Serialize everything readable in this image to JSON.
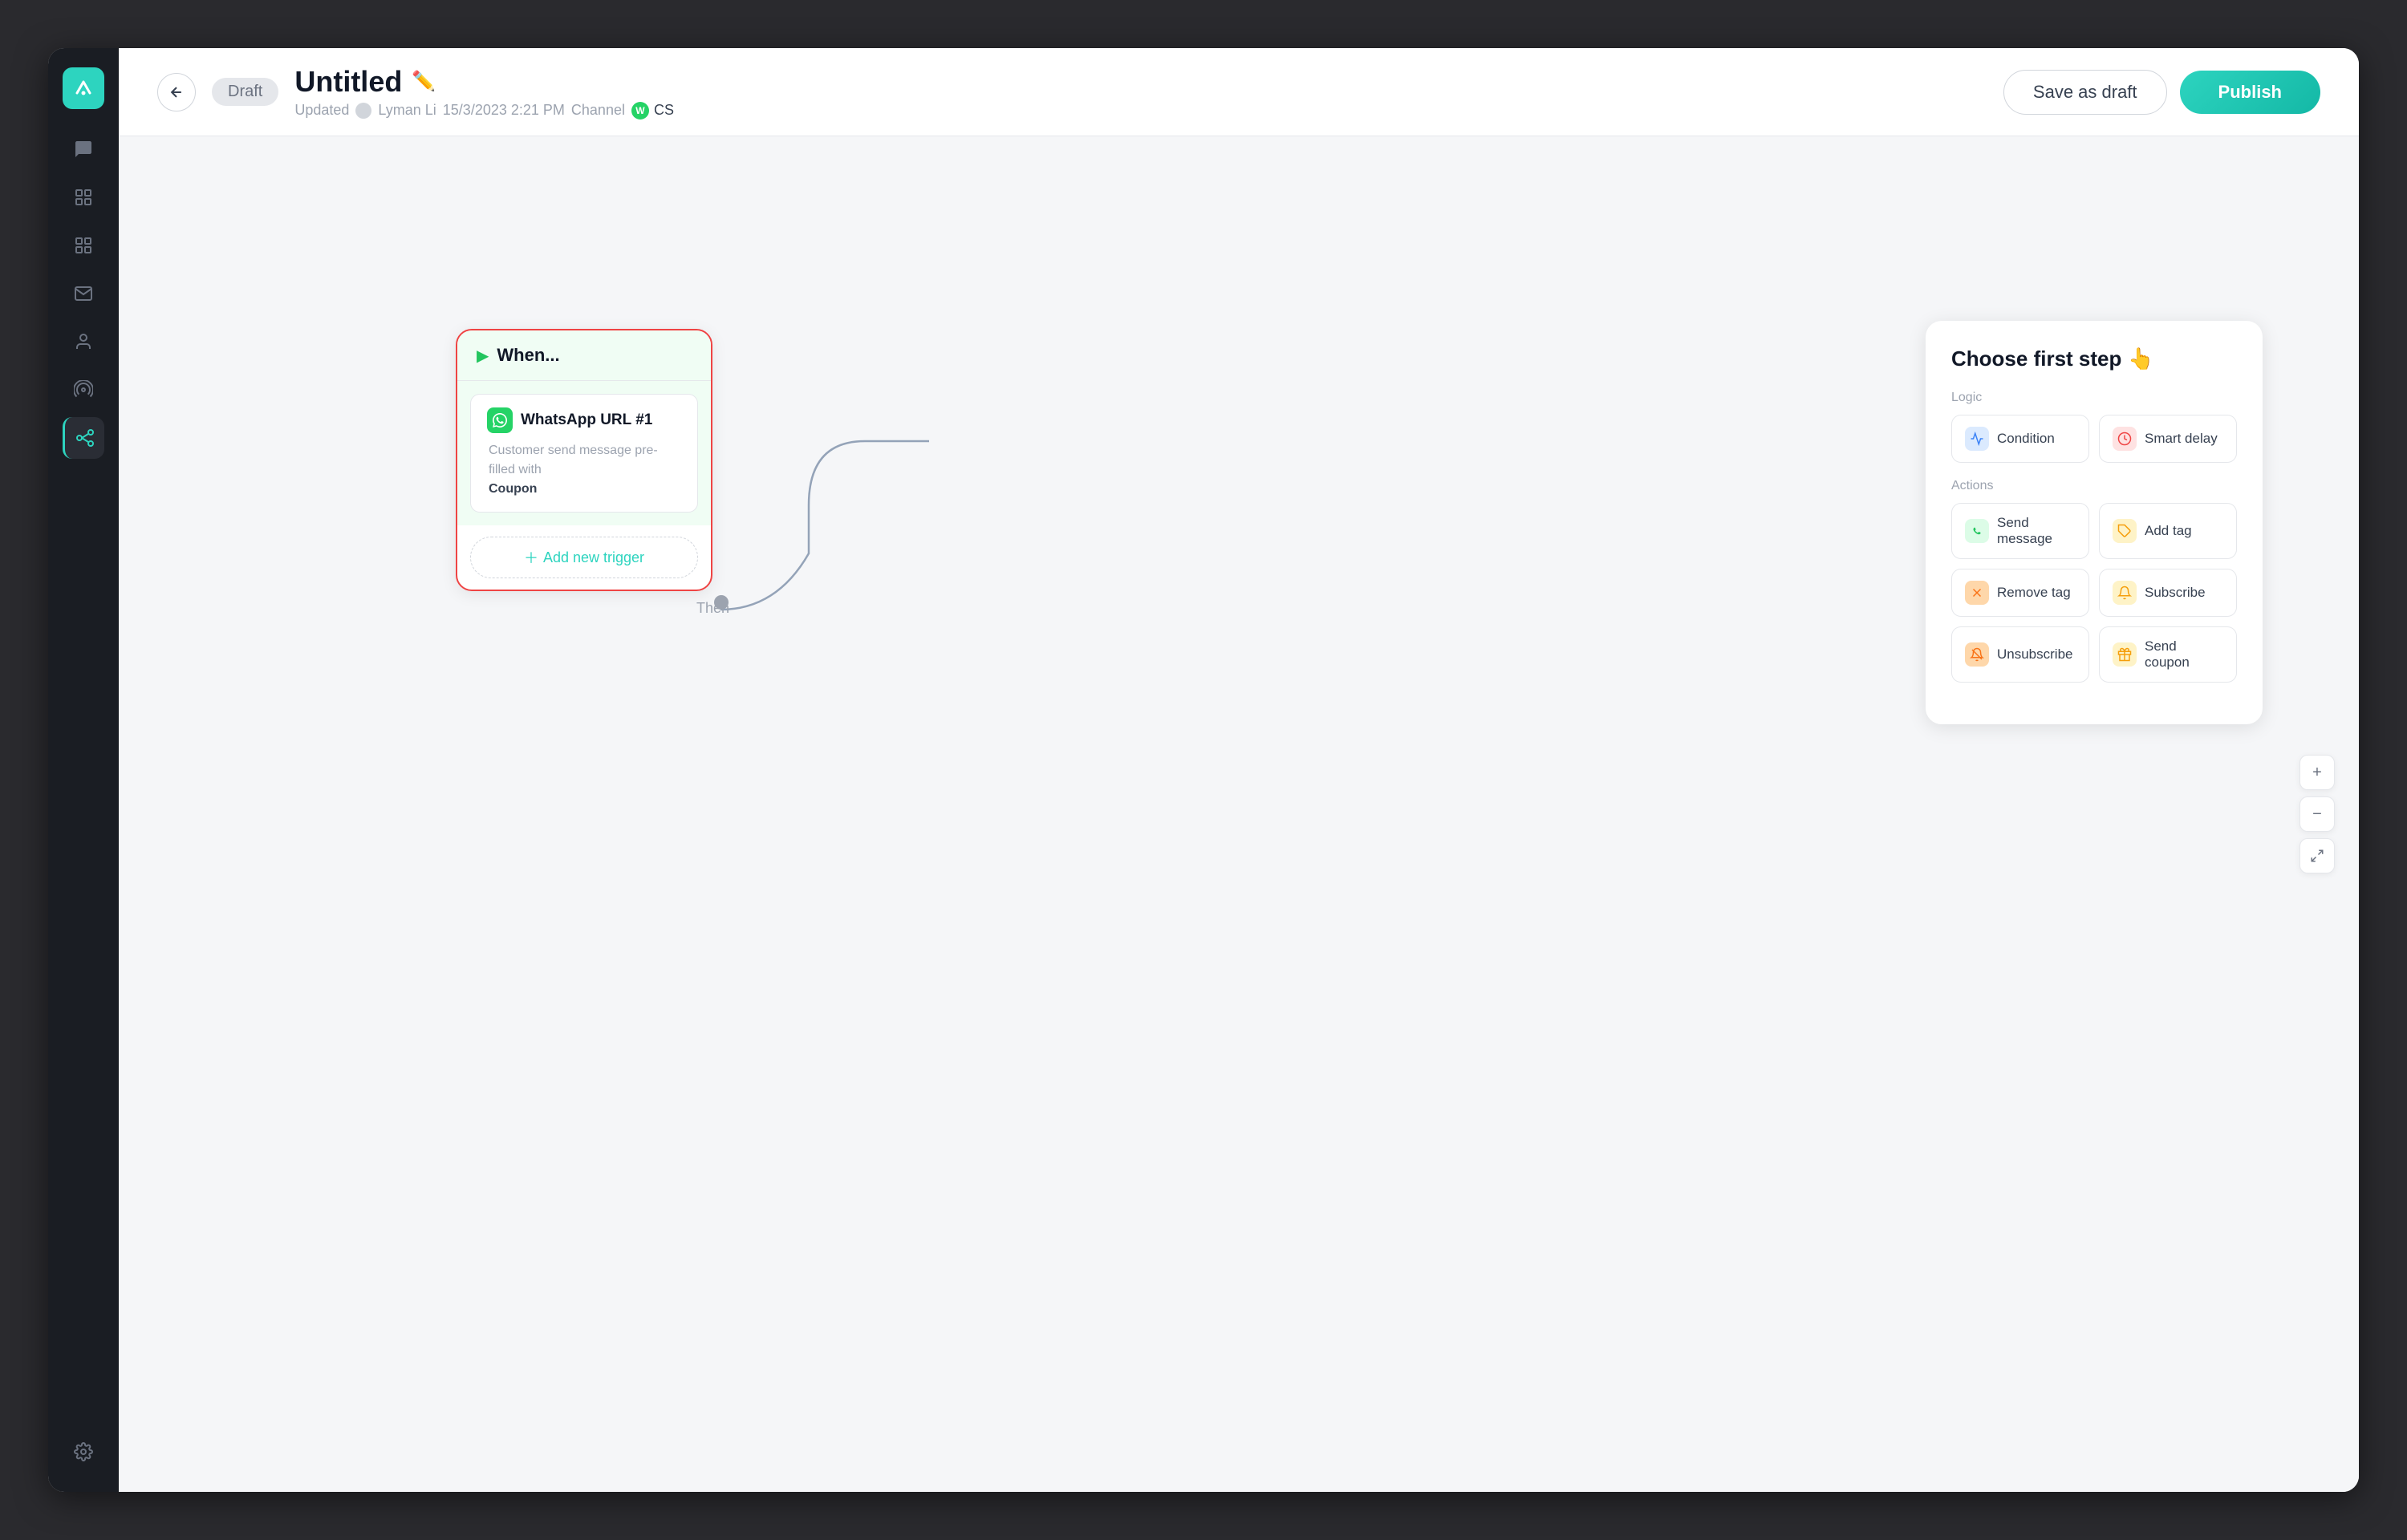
{
  "app": {
    "title": "Untitled",
    "status": "Draft",
    "updated_label": "Updated",
    "updated_by": "Lyman Li",
    "updated_time": "15/3/2023 2:21 PM",
    "channel_label": "Channel",
    "channel_name": "CS",
    "save_draft_label": "Save as draft",
    "publish_label": "Publish",
    "edit_icon": "✏️"
  },
  "sidebar": {
    "items": [
      {
        "name": "chat-icon",
        "label": "Chat",
        "active": false
      },
      {
        "name": "automation-icon",
        "label": "Automation",
        "active": true
      },
      {
        "name": "grid-icon",
        "label": "Grid",
        "active": false
      },
      {
        "name": "inbox-icon",
        "label": "Inbox",
        "active": false
      },
      {
        "name": "contacts-icon",
        "label": "Contacts",
        "active": false
      },
      {
        "name": "broadcast-icon",
        "label": "Broadcast",
        "active": false
      },
      {
        "name": "workflow-icon",
        "label": "Workflow",
        "active": false
      }
    ],
    "settings_label": "Settings"
  },
  "canvas": {
    "when_node": {
      "header_label": "When...",
      "trigger_title": "WhatsApp URL #1",
      "trigger_description": "Customer send  message pre-filled with",
      "trigger_description_bold": "Coupon",
      "add_trigger_label": "Add new trigger"
    },
    "then_label": "Then",
    "choose_panel": {
      "title": "Choose first step",
      "title_emoji": "👆",
      "logic_label": "Logic",
      "actions_label": "Actions",
      "items": [
        {
          "id": "condition",
          "label": "Condition",
          "icon": "🔀",
          "icon_class": "icon-blue"
        },
        {
          "id": "smart-delay",
          "label": "Smart delay",
          "icon": "⏰",
          "icon_class": "icon-red"
        },
        {
          "id": "send-message",
          "label": "Send message",
          "icon": "💬",
          "icon_class": "icon-green"
        },
        {
          "id": "add-tag",
          "label": "Add tag",
          "icon": "🏷️",
          "icon_class": "icon-yellow"
        },
        {
          "id": "remove-tag",
          "label": "Remove tag",
          "icon": "🚫",
          "icon_class": "icon-orange"
        },
        {
          "id": "subscribe",
          "label": "Subscribe",
          "icon": "🔔",
          "icon_class": "icon-yellow"
        },
        {
          "id": "unsubscribe",
          "label": "Unsubscribe",
          "icon": "🔕",
          "icon_class": "icon-orange"
        },
        {
          "id": "send-coupon",
          "label": "Send coupon",
          "icon": "🎫",
          "icon_class": "icon-yellow"
        }
      ]
    }
  },
  "zoom_controls": {
    "zoom_in_label": "+",
    "zoom_out_label": "−",
    "fit_label": "⛶"
  }
}
